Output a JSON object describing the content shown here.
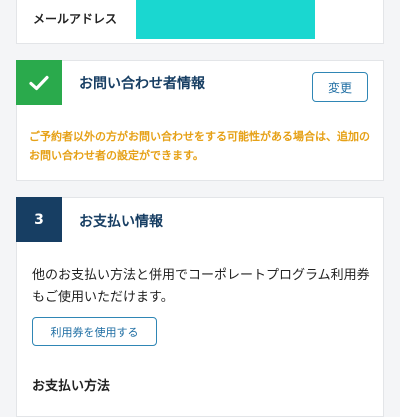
{
  "email": {
    "label": "メールアドレス"
  },
  "contact": {
    "title": "お問い合わせ者情報",
    "change_label": "変更",
    "notice": "ご予約者以外の方がお問い合わせをする可能性がある場合は、追加のお問い合わせ者の設定ができます。"
  },
  "payment": {
    "step_number": "3",
    "title": "お支払い情報",
    "description": "他のお支払い方法と併用でコーポレートプログラム利用券もご使用いただけます。",
    "coupon_button_label": "利用券を使用する",
    "method_heading": "お支払い方法"
  },
  "colors": {
    "step_done": "#2aaa4c",
    "step_active": "#173e63",
    "notice_text": "#e6a117",
    "button_border": "#2f86b5",
    "masked_value": "#1ad7d0"
  }
}
